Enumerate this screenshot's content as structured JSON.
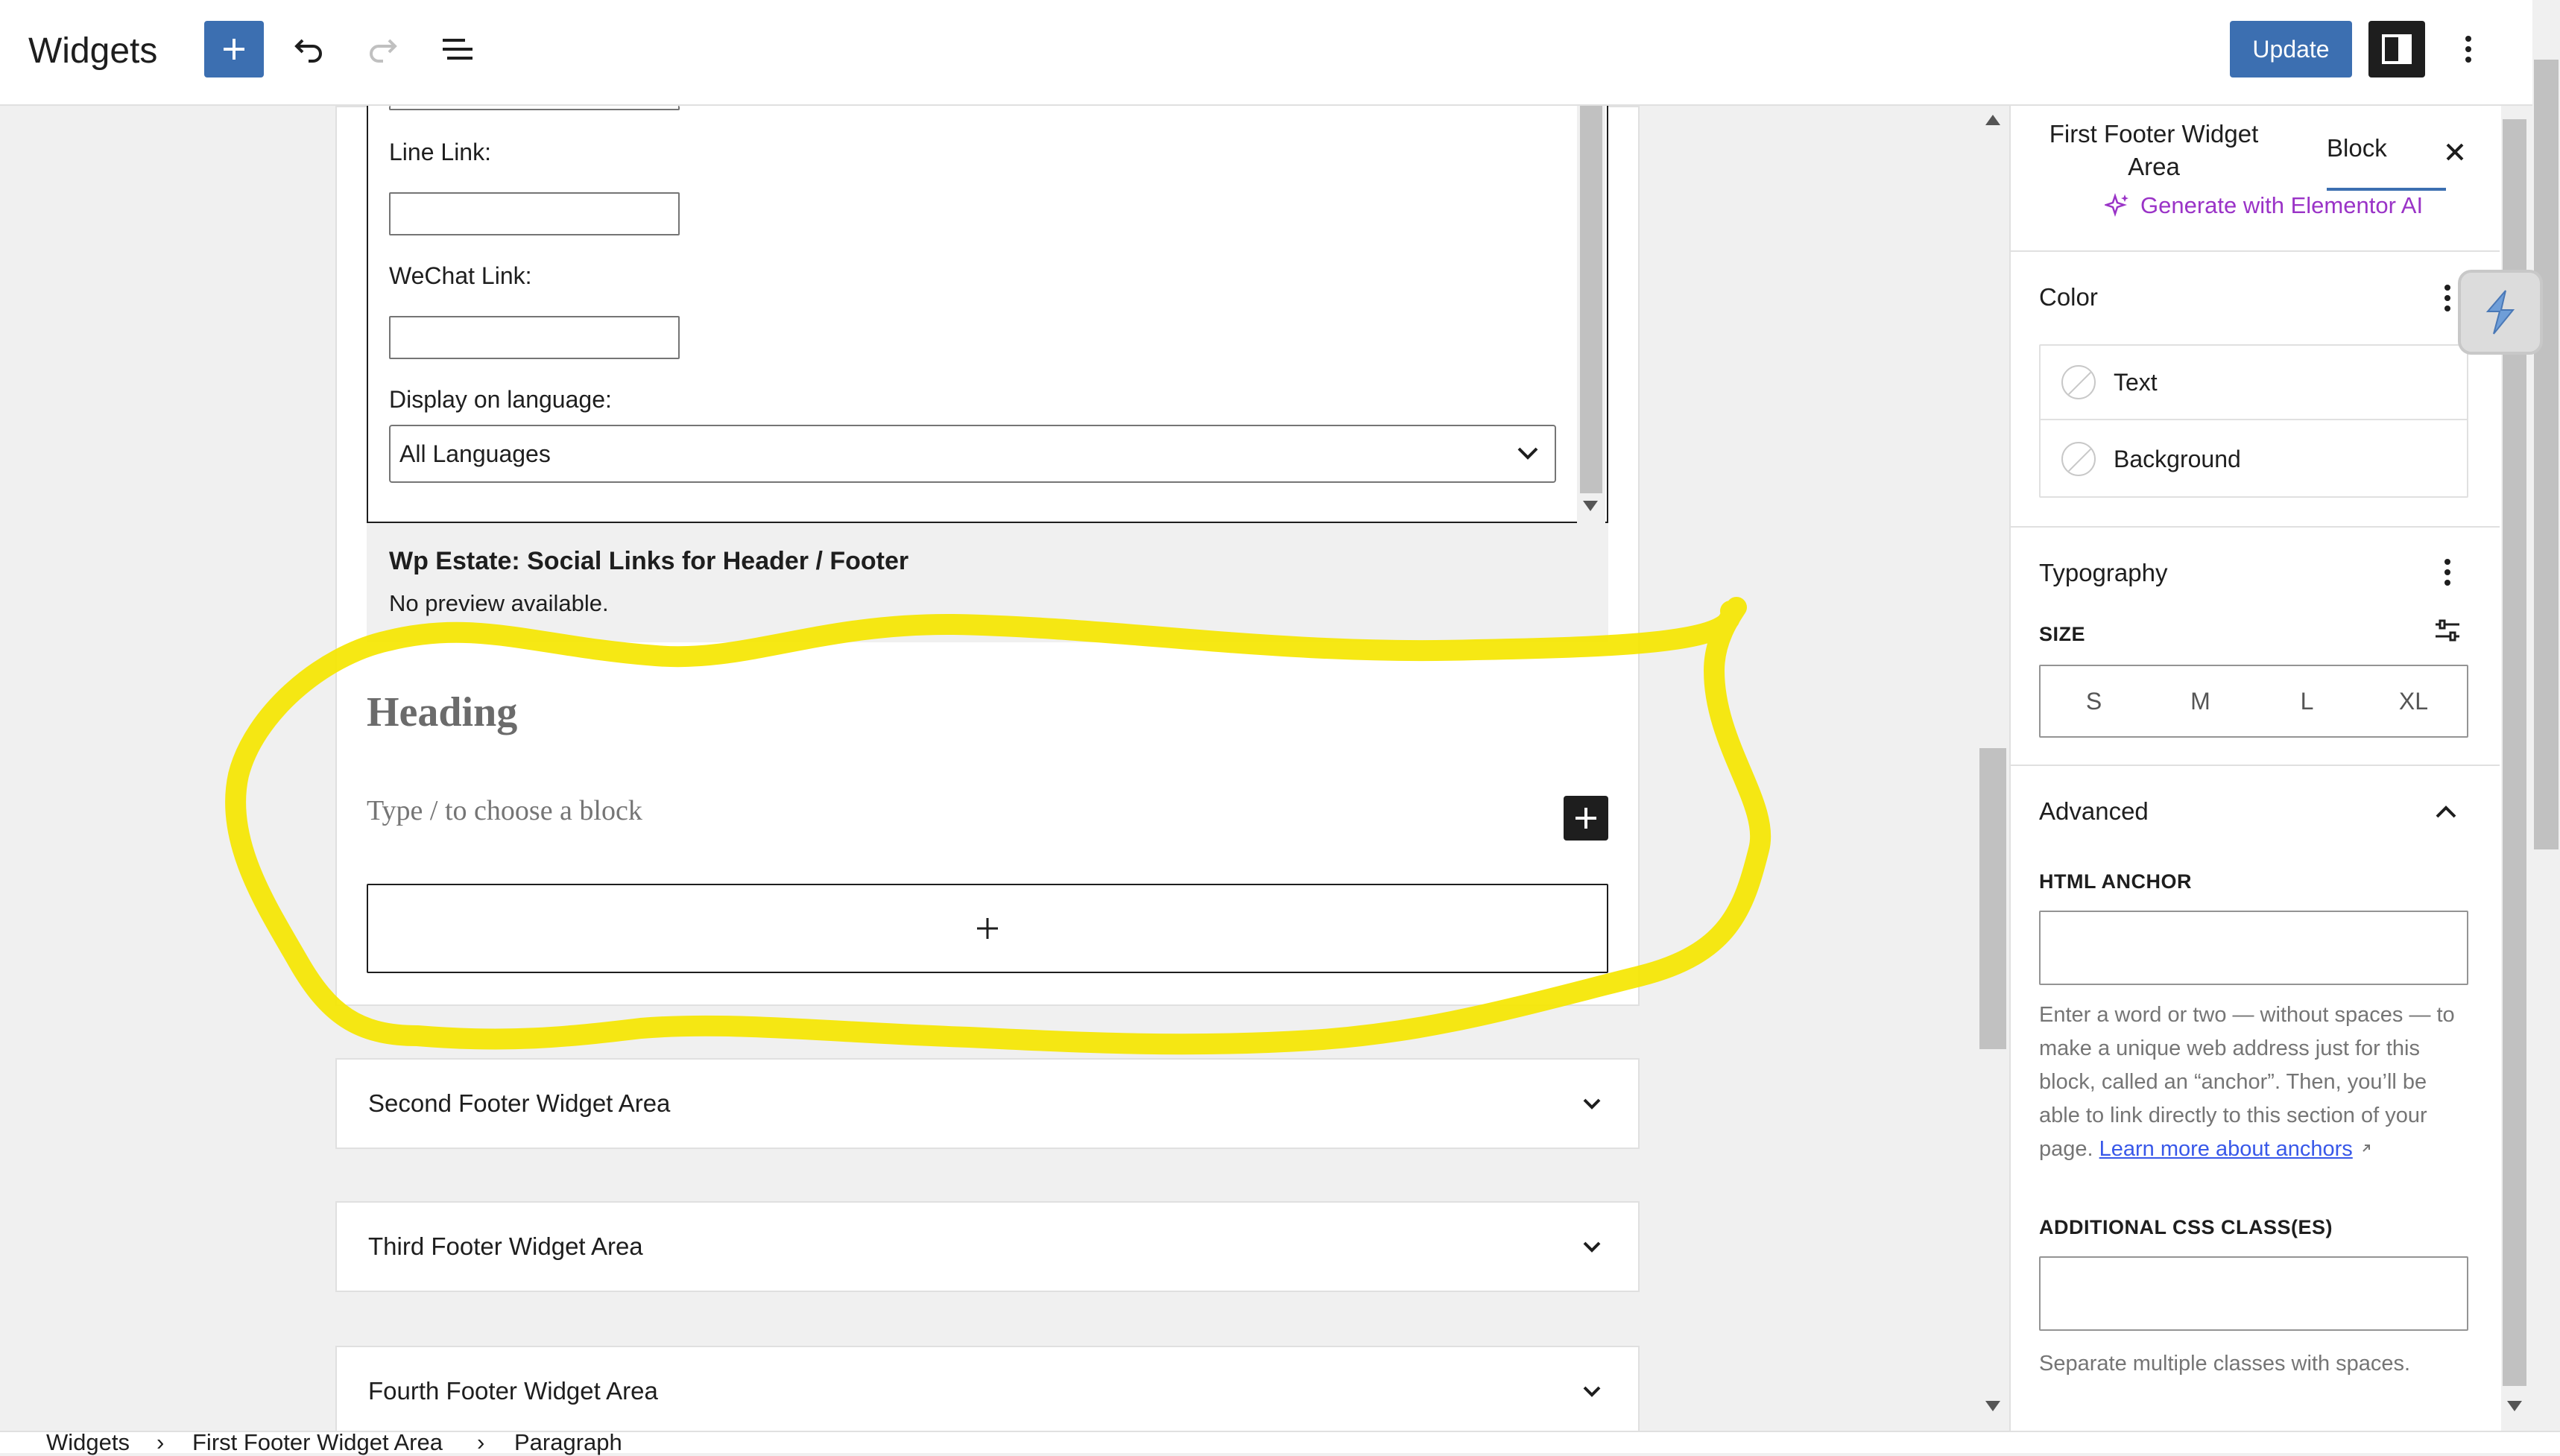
{
  "header": {
    "title": "Widgets",
    "update_label": "Update"
  },
  "widget_form": {
    "line_link_label": "Line Link:",
    "wechat_link_label": "WeChat Link:",
    "display_language_label": "Display on language:",
    "language_selected": "All Languages"
  },
  "preview": {
    "title": "Wp Estate: Social Links for Header / Footer",
    "subtitle": "No preview available."
  },
  "blocks": {
    "heading": "Heading",
    "placeholder": "Type / to choose a block"
  },
  "areas": [
    {
      "label": "Second Footer Widget Area"
    },
    {
      "label": "Third Footer Widget Area"
    },
    {
      "label": "Fourth Footer Widget Area"
    }
  ],
  "breadcrumb": {
    "items": [
      "Widgets",
      "First Footer Widget Area",
      "Paragraph"
    ]
  },
  "sidebar": {
    "tab_area": "First Footer Widget Area",
    "tab_block": "Block",
    "generate_ai": "Generate with Elementor AI",
    "color": {
      "title": "Color",
      "text_label": "Text",
      "background_label": "Background"
    },
    "typography": {
      "title": "Typography",
      "size_label": "SIZE",
      "sizes": [
        "S",
        "M",
        "L",
        "XL"
      ]
    },
    "advanced": {
      "title": "Advanced",
      "html_anchor_label": "HTML ANCHOR",
      "anchor_help": "Enter a word or two — without spaces — to make a unique web address just for this block, called an “anchor”. Then, you’ll be able to link directly to this section of your page.",
      "anchor_link": "Learn more about anchors",
      "css_class_label": "ADDITIONAL CSS CLASS(ES)",
      "css_help": "Separate multiple classes with spaces."
    }
  },
  "colors": {
    "primary": "#3c6fb1",
    "dark": "#1e1e1e",
    "highlight": "#f5e600",
    "ai_purple": "#9a33c7"
  }
}
